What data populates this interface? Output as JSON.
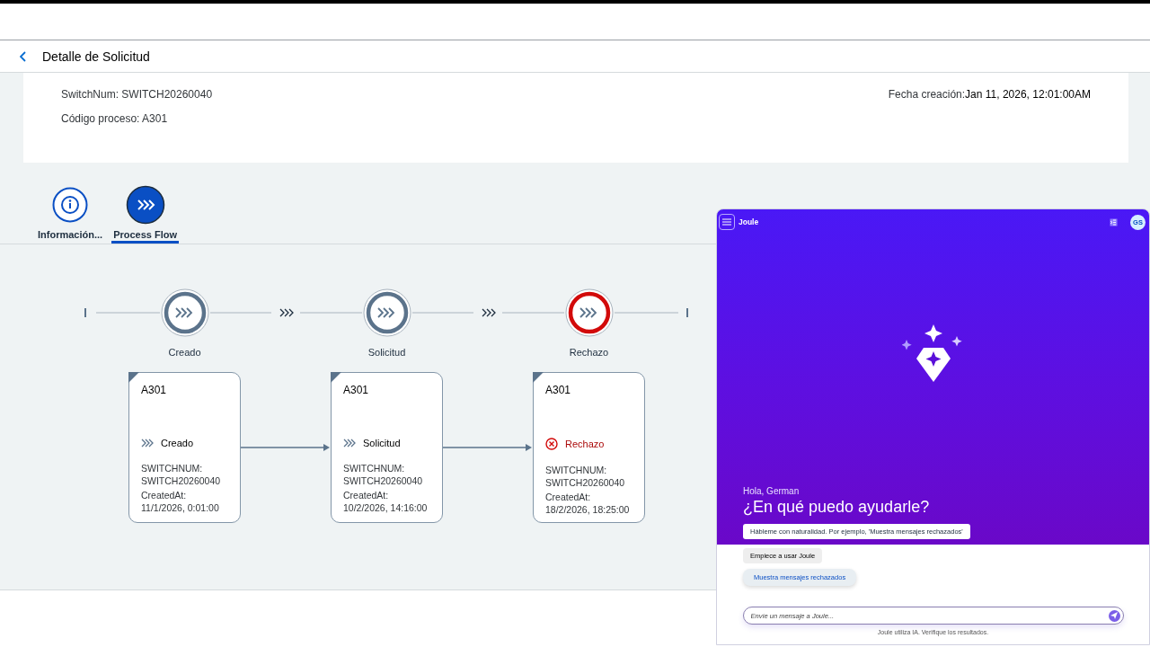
{
  "header": {
    "title": "Detalle de Solicitud"
  },
  "info": {
    "left": [
      {
        "label": "SwitchNum:",
        "value": "SWITCH20260040"
      },
      {
        "label": "Código proceso:",
        "value": "A301"
      }
    ],
    "right": [
      {
        "label": "Fecha creación:",
        "value": "Jan 11, 2026, 12:01:00AM"
      }
    ]
  },
  "tabs": [
    {
      "label": "Información...",
      "selected": false,
      "kind": "info"
    },
    {
      "label": "Process Flow",
      "selected": true,
      "kind": "flow"
    }
  ],
  "flow": {
    "steps": [
      {
        "label": "Creado",
        "negative": false,
        "card": {
          "title": "A301",
          "state": "Creado",
          "lines": [
            "SWITCHNUM:",
            "SWITCH20260040",
            "CreatedAt:",
            "11/1/2026, 0:01:00"
          ]
        }
      },
      {
        "label": "Solicitud",
        "negative": false,
        "card": {
          "title": "A301",
          "state": "Solicitud",
          "lines": [
            "SWITCHNUM:",
            "SWITCH20260040",
            "CreatedAt:",
            "10/2/2026, 14:16:00"
          ]
        }
      },
      {
        "label": "Rechazo",
        "negative": true,
        "card": {
          "title": "A301",
          "state": "Rechazo",
          "lines": [
            "SWITCHNUM:",
            "SWITCH20260040",
            "CreatedAt:",
            "18/2/2026, 18:25:00"
          ]
        }
      }
    ]
  },
  "joule": {
    "title": "Joule",
    "avatar": "GS",
    "greeting": "Hola, German",
    "heading": "¿En qué puedo ayudarle?",
    "hint": "Hábleme con naturalidad. Por ejemplo, 'Muestra mensajes rechazados'",
    "suggestions": [
      {
        "label": "Empiece a usar Joule",
        "hovered": false
      },
      {
        "label": "Muestra mensajes rechazados",
        "hovered": true
      }
    ],
    "placeholder": "Envíe un mensaje a Joule...",
    "disclaimer": "Joule utiliza IA. Verifique los resultados."
  }
}
